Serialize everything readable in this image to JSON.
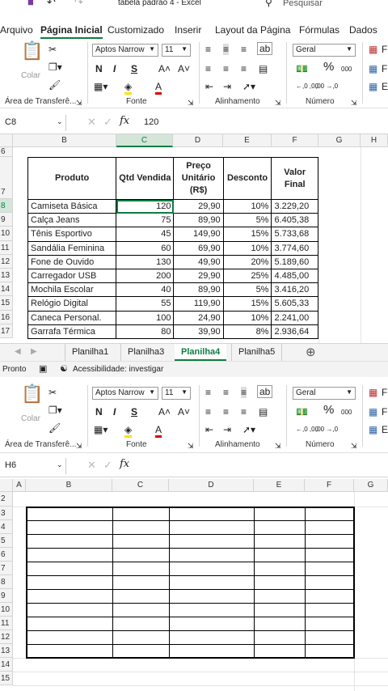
{
  "window": {
    "title": "tabela padrão 4 - Excel",
    "search_placeholder": "Pesquisar"
  },
  "menu": [
    "Arquivo",
    "Página Inicial",
    "Customizado",
    "Inserir",
    "Layout da Página",
    "Fórmulas",
    "Dados"
  ],
  "ribbon": {
    "paste_label": "Colar",
    "font_name": "Aptos Narrow",
    "font_size": "11",
    "number_format": "Geral",
    "bold": "N",
    "italic": "I",
    "underline": "S",
    "grow_font": "A˄",
    "shrink_font": "A˅",
    "groups": [
      "Área de Transferê...",
      "Fonte",
      "Alinhamento",
      "Número"
    ],
    "percent": "%",
    "thousands": "000",
    "dec_inc": "←,0 ,00",
    "dec_dec": ",00 →,0",
    "right_labels": [
      "F",
      "F",
      "E"
    ]
  },
  "formula_bar_top": {
    "cell_ref": "C8",
    "value": "120"
  },
  "formula_bar_bottom": {
    "cell_ref": "H6",
    "value": ""
  },
  "sheet_top": {
    "columns": [
      "B",
      "C",
      "D",
      "E",
      "F",
      "G",
      "H"
    ],
    "rows": [
      "6",
      "7",
      "8",
      "9",
      "10",
      "11",
      "12",
      "13",
      "14",
      "15",
      "16",
      "17"
    ],
    "headers": [
      "Produto",
      "Qtd Vendida",
      "Preço Unitário (R$)",
      "Desconto",
      "Valor Final"
    ],
    "data": [
      [
        "Camiseta Básica",
        "120",
        "29,90",
        "10%",
        "3.229,20"
      ],
      [
        "Calça Jeans",
        "75",
        "89,90",
        "5%",
        "6.405,38"
      ],
      [
        "Tênis Esportivo",
        "45",
        "149,90",
        "15%",
        "5.733,68"
      ],
      [
        "Sandália Feminina",
        "60",
        "69,90",
        "10%",
        "3.774,60"
      ],
      [
        "Fone de Ouvido",
        "130",
        "49,90",
        "20%",
        "5.189,60"
      ],
      [
        "Carregador USB",
        "200",
        "29,90",
        "25%",
        "4.485,00"
      ],
      [
        "Mochila Escolar",
        "40",
        "89,90",
        "5%",
        "3.416,20"
      ],
      [
        "Relógio Digital",
        "55",
        "119,90",
        "15%",
        "5.605,33"
      ],
      [
        "Caneca Personal.",
        "100",
        "24,90",
        "10%",
        "2.241,00"
      ],
      [
        "Garrafa Térmica",
        "80",
        "39,90",
        "8%",
        "2.936,64"
      ]
    ]
  },
  "tabs": [
    "Planilha1",
    "Planilha3",
    "Planilha4",
    "Planilha5"
  ],
  "active_tab": "Planilha4",
  "add_sheet": "⊕",
  "status": {
    "ready": "Pronto",
    "accessibility": "Acessibilidade: investigar"
  },
  "sheet_bottom": {
    "columns": [
      "A",
      "B",
      "C",
      "D",
      "E",
      "F",
      "G"
    ],
    "rows": [
      "2",
      "3",
      "4",
      "5",
      "6",
      "7",
      "8",
      "9",
      "10",
      "11",
      "12",
      "13",
      "14",
      "15"
    ]
  },
  "colors": {
    "accent": "#107c41",
    "header_bg": "#f3f3f3"
  }
}
